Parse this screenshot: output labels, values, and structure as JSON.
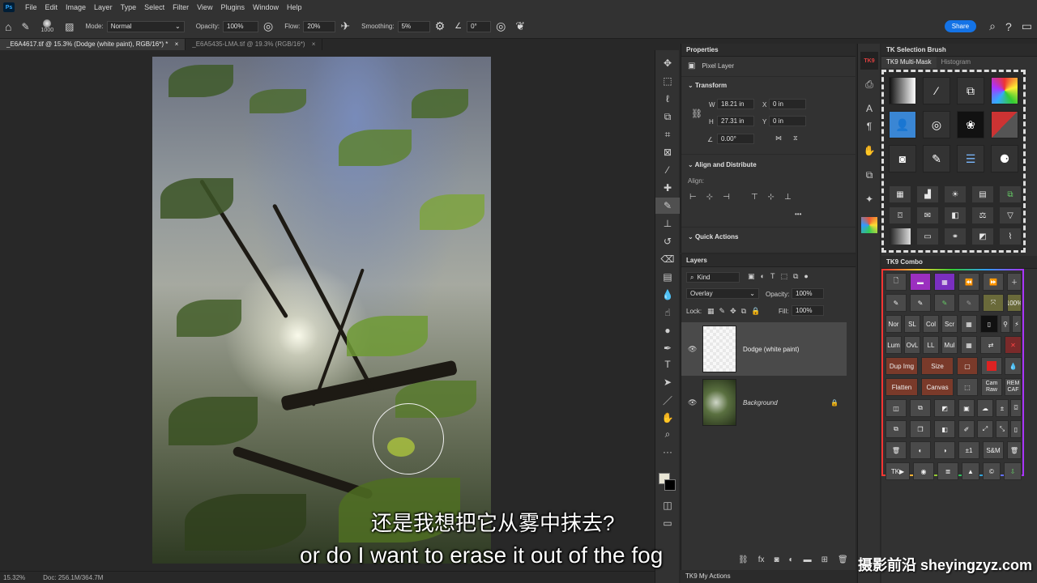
{
  "menu": [
    "File",
    "Edit",
    "Image",
    "Layer",
    "Type",
    "Select",
    "Filter",
    "View",
    "Plugins",
    "Window",
    "Help"
  ],
  "app_logo": "Ps",
  "options": {
    "brush_size": "1000",
    "mode_label": "Mode:",
    "mode_value": "Normal",
    "opacity_label": "Opacity:",
    "opacity_value": "100%",
    "flow_label": "Flow:",
    "flow_value": "20%",
    "smoothing_label": "Smoothing:",
    "smoothing_value": "5%",
    "angle_value": "0°",
    "share_label": "Share"
  },
  "tabs": [
    {
      "label": "_E6A4617.tif @ 15.3% (Dodge (white paint), RGB/16*) *",
      "active": true
    },
    {
      "label": "_E6A5435-LMA.tif @ 19.3% (RGB/16*)",
      "active": false
    }
  ],
  "status": {
    "zoom": "15.32%",
    "doc": "Doc: 256.1M/364.7M"
  },
  "properties": {
    "title": "Properties",
    "layer_type": "Pixel Layer",
    "transform_title": "Transform",
    "w_label": "W",
    "w_value": "18.21 in",
    "h_label": "H",
    "h_value": "27.31 in",
    "x_label": "X",
    "x_value": "0 in",
    "y_label": "Y",
    "y_value": "0 in",
    "angle_value": "0.00°",
    "align_title": "Align and Distribute",
    "align_label": "Align:",
    "quick_actions": "Quick Actions"
  },
  "layers": {
    "title": "Layers",
    "filter_kind": "Kind",
    "blend_mode": "Overlay",
    "opacity_label": "Opacity:",
    "opacity_value": "100%",
    "lock_label": "Lock:",
    "fill_label": "Fill:",
    "fill_value": "100%",
    "items": [
      {
        "name": "Dodge (white paint)",
        "selected": true
      },
      {
        "name": "Background",
        "selected": false
      }
    ],
    "fx_label": "fx"
  },
  "tk": {
    "selection_brush": "TK Selection Brush",
    "multi_mask_tab": "TK9 Multi-Mask",
    "histogram_tab": "Histogram",
    "combo_title": "TK9 Combo",
    "strip_logo": "TK9",
    "my_actions": "TK9 My Actions",
    "combo_buttons": {
      "r3": [
        "Nor",
        "SL",
        "Col",
        "Scr"
      ],
      "r4": [
        "Lum",
        "OvL",
        "LL",
        "Mul"
      ],
      "dup": "Dup Img",
      "size": "Size",
      "flatten": "Flatten",
      "canvas": "Canvas",
      "camraw": "Cam Raw",
      "remcaf": "REM CAF",
      "pct": "100%",
      "sm": "S&M",
      "pm": "±1",
      "tk": "TK▶"
    }
  },
  "subtitles": {
    "zh": "还是我想把它从雾中抹去?",
    "en": "or do I want to erase it out of the fog"
  },
  "watermark": "摄影前沿 sheyingzyz.com"
}
